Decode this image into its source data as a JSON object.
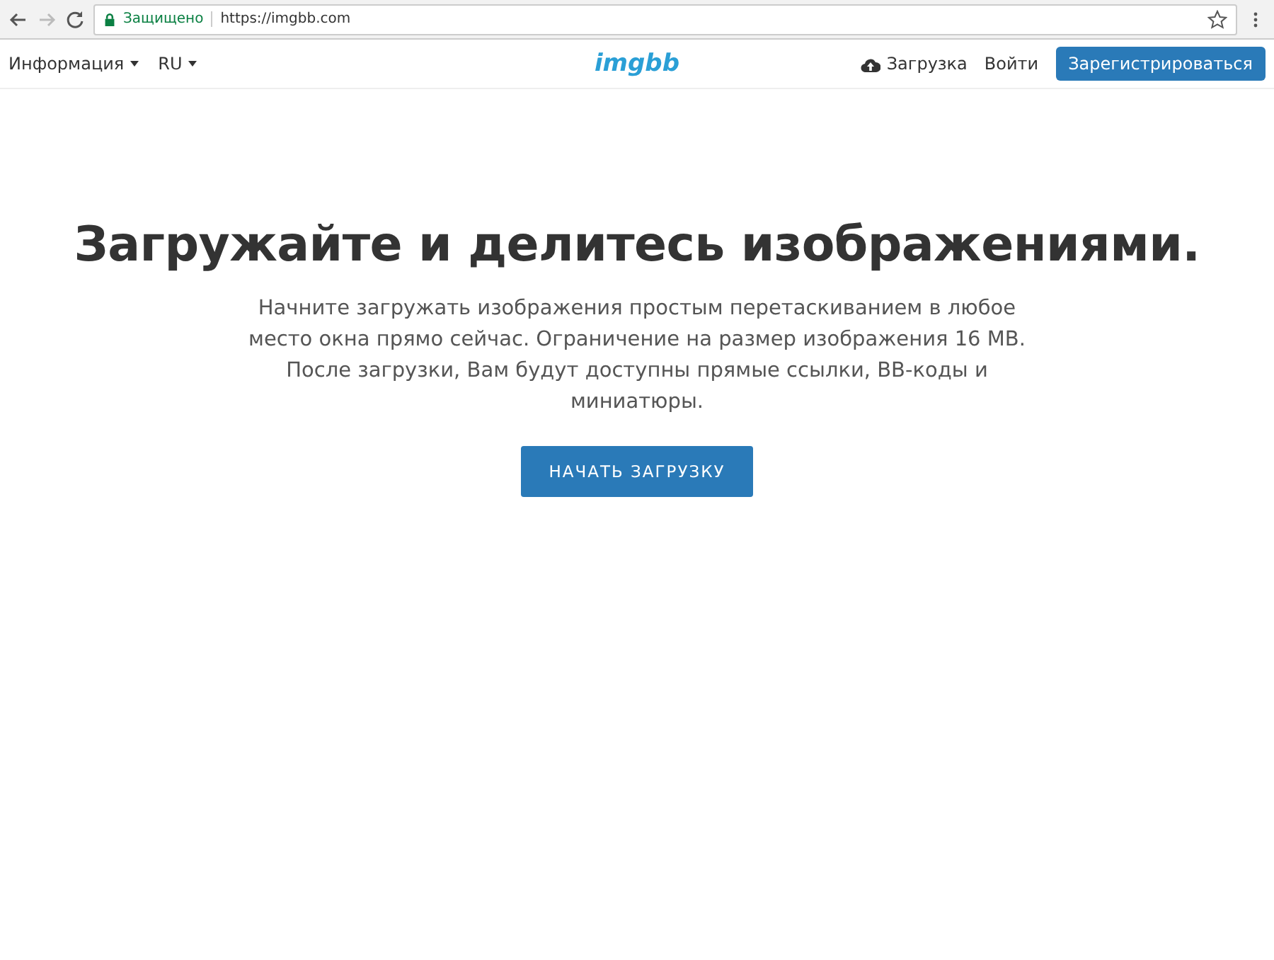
{
  "browser": {
    "security_label": "Защищено",
    "url": "https://imgbb.com"
  },
  "navbar": {
    "left_menus": [
      {
        "label": "Информация"
      },
      {
        "label": "RU"
      }
    ],
    "logo": "imgbb",
    "upload_link": "Загрузка",
    "login_link": "Войти",
    "signup_button": "Зарегистрироваться"
  },
  "hero": {
    "title": "Загружайте и делитесь изображениями.",
    "description": "Начните загружать изображения простым перетаскиванием в любое место окна прямо сейчас. Ограничение на размер изображения 16 MB. После загрузки, Вам будут доступны прямые ссылки, BB-коды и миниатюры.",
    "button": "НАЧАТЬ ЗАГРУЗКУ"
  }
}
